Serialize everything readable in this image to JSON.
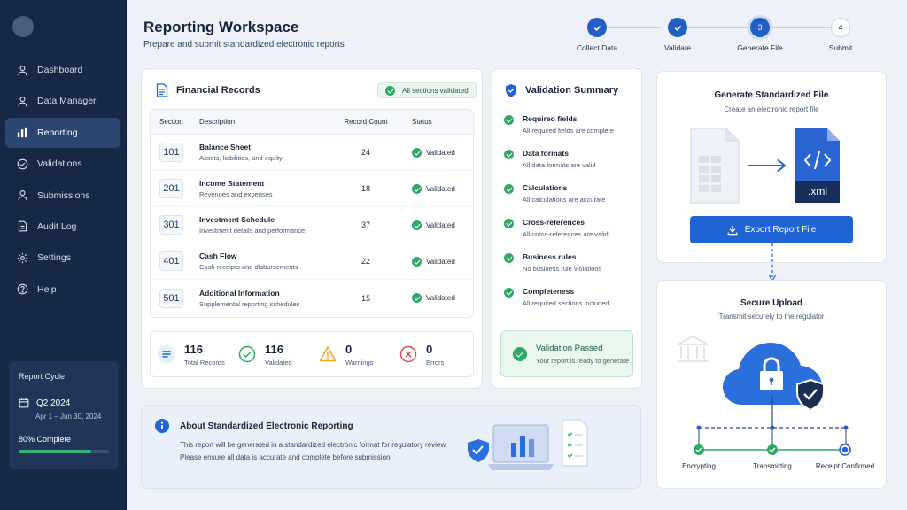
{
  "header": {
    "title": "Reporting Workspace",
    "subtitle": "Prepare and submit standardized electronic reports"
  },
  "sidebar": {
    "items": [
      {
        "label": "Dashboard",
        "icon": "user-icon"
      },
      {
        "label": "Data Manager",
        "icon": "user-icon"
      },
      {
        "label": "Reporting",
        "icon": "bar-chart-icon",
        "active": true
      },
      {
        "label": "Validations",
        "icon": "check-circle-icon"
      },
      {
        "label": "Submissions",
        "icon": "user-icon"
      },
      {
        "label": "Audit Log",
        "icon": "document-icon"
      },
      {
        "label": "Settings",
        "icon": "gear-icon"
      },
      {
        "label": "Help",
        "icon": "help-icon"
      }
    ],
    "report_cycle": {
      "title": "Report Cycle",
      "quarter": "Q2 2024",
      "range": "Apr 1 – Jun 30, 2024",
      "progress_label": "80% Complete",
      "progress": 80
    }
  },
  "stepper": {
    "steps": [
      {
        "label": "Collect Data",
        "state": "done"
      },
      {
        "label": "Validate",
        "state": "done"
      },
      {
        "label": "Generate File",
        "state": "current",
        "number": "3"
      },
      {
        "label": "Submit",
        "state": "todo",
        "number": "4"
      }
    ]
  },
  "records": {
    "title": "Financial Records",
    "badge": "All sections validated",
    "columns": [
      "Section",
      "Description",
      "Record Count",
      "Status"
    ],
    "rows": [
      {
        "section": "101",
        "name": "Balance Sheet",
        "desc": "Assets, liabilities, and equity",
        "count": "24",
        "status": "Validated"
      },
      {
        "section": "201",
        "name": "Income Statement",
        "desc": "Revenues and expenses",
        "count": "18",
        "status": "Validated"
      },
      {
        "section": "301",
        "name": "Investment Schedule",
        "desc": "Investment details and performance",
        "count": "37",
        "status": "Validated"
      },
      {
        "section": "401",
        "name": "Cash Flow",
        "desc": "Cash receipts and disbursements",
        "count": "22",
        "status": "Validated"
      },
      {
        "section": "501",
        "name": "Additional Information",
        "desc": "Supplemental reporting schedules",
        "count": "15",
        "status": "Validated"
      }
    ],
    "stats": [
      {
        "value": "116",
        "label": "Total Records"
      },
      {
        "value": "116",
        "label": "Validated"
      },
      {
        "value": "0",
        "label": "Warnings"
      },
      {
        "value": "0",
        "label": "Errors"
      }
    ]
  },
  "validation": {
    "title": "Validation Summary",
    "items": [
      {
        "title": "Required fields",
        "desc": "All required fields are complete"
      },
      {
        "title": "Data formats",
        "desc": "All data formats are valid"
      },
      {
        "title": "Calculations",
        "desc": "All calculations are accurate"
      },
      {
        "title": "Cross-references",
        "desc": "All cross-references are valid"
      },
      {
        "title": "Business rules",
        "desc": "No business rule violations"
      },
      {
        "title": "Completeness",
        "desc": "All required sections included"
      }
    ],
    "passed_title": "Validation Passed",
    "passed_desc": "Your report is ready to generate"
  },
  "generate": {
    "title": "Generate Standardized File",
    "subtitle": "Create an electronic report file",
    "file_ext": ".xml",
    "button": "Export Report File"
  },
  "upload": {
    "title": "Secure Upload",
    "subtitle": "Transmit securely to the regulator",
    "stages": [
      "Encrypting",
      "Transmitting",
      "Receipt Confirmed"
    ]
  },
  "about": {
    "title": "About Standardized Electronic Reporting",
    "line1": "This report will be generated in a standardized electronic format for regulatory review.",
    "line2": "Please ensure all data is accurate and complete before submission."
  },
  "colors": {
    "sidebar": "#162845",
    "accent": "#1f63d4",
    "success": "#2fa866",
    "warning": "#f0a323",
    "error": "#d94b4b"
  }
}
